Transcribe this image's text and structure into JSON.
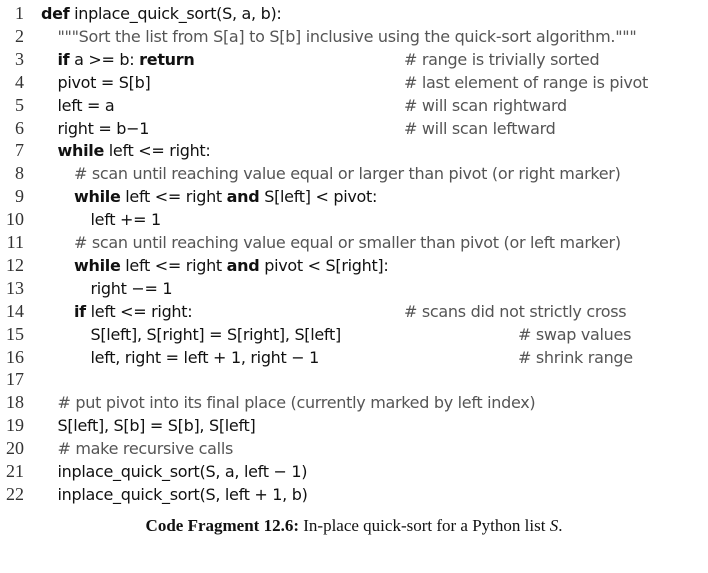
{
  "code_fragment": {
    "lines": [
      {
        "num": "1",
        "indent": 0,
        "parts": [
          {
            "t": "def",
            "k": "kw"
          },
          {
            "t": " inplace_quick_sort(S, a, b):",
            "k": ""
          }
        ],
        "comment": ""
      },
      {
        "num": "2",
        "indent": 1,
        "parts": [
          {
            "t": "\"\"\"Sort the list from S[a] to S[b] inclusive using the quick-sort algorithm.\"\"\"",
            "k": "cm"
          }
        ],
        "comment": ""
      },
      {
        "num": "3",
        "indent": 1,
        "parts": [
          {
            "t": "if",
            "k": "kw"
          },
          {
            "t": " a >= b: ",
            "k": ""
          },
          {
            "t": "return",
            "k": "kw"
          }
        ],
        "comment": "# range is trivially sorted"
      },
      {
        "num": "4",
        "indent": 1,
        "parts": [
          {
            "t": "pivot = S[b]",
            "k": ""
          }
        ],
        "comment": "# last element of range is pivot"
      },
      {
        "num": "5",
        "indent": 1,
        "parts": [
          {
            "t": "left = a",
            "k": ""
          }
        ],
        "comment": "# will scan rightward"
      },
      {
        "num": "6",
        "indent": 1,
        "parts": [
          {
            "t": "right = b−1",
            "k": ""
          }
        ],
        "comment": "# will scan leftward"
      },
      {
        "num": "7",
        "indent": 1,
        "parts": [
          {
            "t": "while",
            "k": "kw"
          },
          {
            "t": " left <= right:",
            "k": ""
          }
        ],
        "comment": ""
      },
      {
        "num": "8",
        "indent": 2,
        "parts": [
          {
            "t": "# scan until reaching value equal or larger than pivot (or right marker)",
            "k": "cm"
          }
        ],
        "comment": ""
      },
      {
        "num": "9",
        "indent": 2,
        "parts": [
          {
            "t": "while",
            "k": "kw"
          },
          {
            "t": " left <= right ",
            "k": ""
          },
          {
            "t": "and",
            "k": "kw"
          },
          {
            "t": " S[left] < pivot:",
            "k": ""
          }
        ],
        "comment": ""
      },
      {
        "num": "10",
        "indent": 3,
        "parts": [
          {
            "t": "left += 1",
            "k": ""
          }
        ],
        "comment": ""
      },
      {
        "num": "11",
        "indent": 2,
        "parts": [
          {
            "t": "# scan until reaching value equal or smaller than pivot (or left marker)",
            "k": "cm"
          }
        ],
        "comment": ""
      },
      {
        "num": "12",
        "indent": 2,
        "parts": [
          {
            "t": "while",
            "k": "kw"
          },
          {
            "t": " left <= right ",
            "k": ""
          },
          {
            "t": "and",
            "k": "kw"
          },
          {
            "t": " pivot < S[right]:",
            "k": ""
          }
        ],
        "comment": ""
      },
      {
        "num": "13",
        "indent": 3,
        "parts": [
          {
            "t": "right −= 1",
            "k": ""
          }
        ],
        "comment": ""
      },
      {
        "num": "14",
        "indent": 2,
        "parts": [
          {
            "t": "if",
            "k": "kw"
          },
          {
            "t": " left <= right:",
            "k": ""
          }
        ],
        "comment": "# scans did not strictly cross"
      },
      {
        "num": "15",
        "indent": 3,
        "parts": [
          {
            "t": "S[left], S[right] = S[right], S[left]",
            "k": ""
          }
        ],
        "comment": "# swap values",
        "comment_far": true
      },
      {
        "num": "16",
        "indent": 3,
        "parts": [
          {
            "t": "left, right = left + 1, right − 1",
            "k": ""
          }
        ],
        "comment": "# shrink range",
        "comment_far": true
      },
      {
        "num": "17",
        "indent": 0,
        "parts": [],
        "comment": ""
      },
      {
        "num": "18",
        "indent": 1,
        "parts": [
          {
            "t": "# put pivot into its final place (currently marked by left index)",
            "k": "cm"
          }
        ],
        "comment": ""
      },
      {
        "num": "19",
        "indent": 1,
        "parts": [
          {
            "t": "S[left], S[b] = S[b], S[left]",
            "k": ""
          }
        ],
        "comment": ""
      },
      {
        "num": "20",
        "indent": 1,
        "parts": [
          {
            "t": "# make recursive calls",
            "k": "cm"
          }
        ],
        "comment": ""
      },
      {
        "num": "21",
        "indent": 1,
        "parts": [
          {
            "t": "inplace_quick_sort(S, a, left − 1)",
            "k": ""
          }
        ],
        "comment": ""
      },
      {
        "num": "22",
        "indent": 1,
        "parts": [
          {
            "t": "inplace_quick_sort(S, left + 1, b)",
            "k": ""
          }
        ],
        "comment": ""
      }
    ]
  },
  "caption": {
    "label": "Code Fragment 12.6:",
    "text": " In-place quick-sort for a Python list ",
    "var": "S",
    "end": "."
  }
}
